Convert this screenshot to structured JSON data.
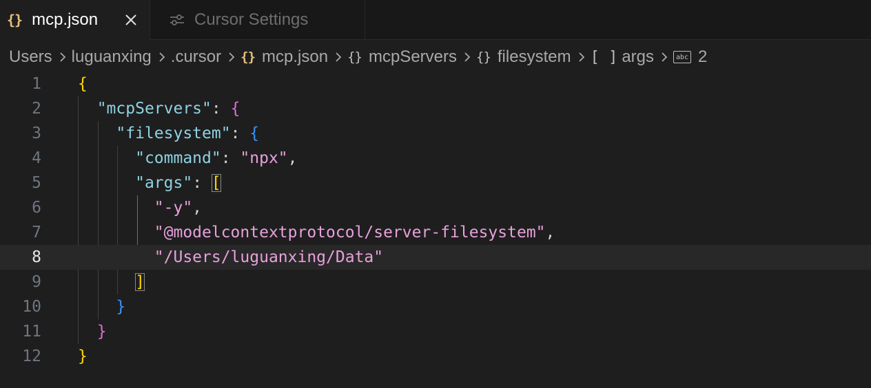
{
  "tabs": [
    {
      "label": "mcp.json",
      "icon": "json-braces-icon",
      "active": true
    },
    {
      "label": "Cursor Settings",
      "icon": "settings-sliders-icon",
      "active": false
    }
  ],
  "breadcrumb": [
    {
      "label": "Users",
      "icon": ""
    },
    {
      "label": "luguanxing",
      "icon": ""
    },
    {
      "label": ".cursor",
      "icon": ""
    },
    {
      "label": "mcp.json",
      "icon": "json-braces-icon"
    },
    {
      "label": "mcpServers",
      "icon": "object-braces-icon"
    },
    {
      "label": "filesystem",
      "icon": "object-braces-icon"
    },
    {
      "label": "args",
      "icon": "array-brackets-icon"
    },
    {
      "label": "2",
      "icon": "string-abc-icon"
    }
  ],
  "icon_glyphs": {
    "braces": "{}",
    "brackets": "[ ]",
    "abc": "abc"
  },
  "editor": {
    "current_line": 8,
    "lines": [
      {
        "number": "1",
        "tokens": [
          {
            "t": "{",
            "c": "b1"
          }
        ]
      },
      {
        "number": "2",
        "tokens": [
          {
            "t": "  "
          },
          {
            "t": "\"mcpServers\"",
            "c": "key"
          },
          {
            "t": ": ",
            "c": "punc"
          },
          {
            "t": "{",
            "c": "b2"
          }
        ]
      },
      {
        "number": "3",
        "tokens": [
          {
            "t": "    "
          },
          {
            "t": "\"filesystem\"",
            "c": "key"
          },
          {
            "t": ": ",
            "c": "punc"
          },
          {
            "t": "{",
            "c": "b3"
          }
        ]
      },
      {
        "number": "4",
        "tokens": [
          {
            "t": "      "
          },
          {
            "t": "\"command\"",
            "c": "key"
          },
          {
            "t": ": ",
            "c": "punc"
          },
          {
            "t": "\"npx\"",
            "c": "str"
          },
          {
            "t": ",",
            "c": "punc"
          }
        ]
      },
      {
        "number": "5",
        "tokens": [
          {
            "t": "      "
          },
          {
            "t": "\"args\"",
            "c": "key"
          },
          {
            "t": ": ",
            "c": "punc"
          },
          {
            "t": "[",
            "c": "b1",
            "match": true
          }
        ]
      },
      {
        "number": "6",
        "tokens": [
          {
            "t": "        "
          },
          {
            "t": "\"-y\"",
            "c": "str"
          },
          {
            "t": ",",
            "c": "punc"
          }
        ]
      },
      {
        "number": "7",
        "tokens": [
          {
            "t": "        "
          },
          {
            "t": "\"@modelcontextprotocol/server-filesystem\"",
            "c": "str"
          },
          {
            "t": ",",
            "c": "punc"
          }
        ]
      },
      {
        "number": "8",
        "tokens": [
          {
            "t": "        "
          },
          {
            "t": "\"/Users/luguanxing/Data\"",
            "c": "str"
          }
        ]
      },
      {
        "number": "9",
        "tokens": [
          {
            "t": "      "
          },
          {
            "t": "]",
            "c": "b1",
            "match": true
          }
        ]
      },
      {
        "number": "10",
        "tokens": [
          {
            "t": "    "
          },
          {
            "t": "}",
            "c": "b3"
          }
        ]
      },
      {
        "number": "11",
        "tokens": [
          {
            "t": "  "
          },
          {
            "t": "}",
            "c": "b2"
          }
        ]
      },
      {
        "number": "12",
        "tokens": [
          {
            "t": "}",
            "c": "b1"
          }
        ]
      }
    ]
  },
  "colors": {
    "background": "#1e1e1e",
    "tab_bar": "#181818",
    "key": "#8fd2e3",
    "string": "#e8a0dc",
    "bracket_gold": "#ffd700",
    "bracket_orchid": "#da70d6",
    "bracket_blue": "#3794ff",
    "json_icon": "#e5c07b"
  }
}
